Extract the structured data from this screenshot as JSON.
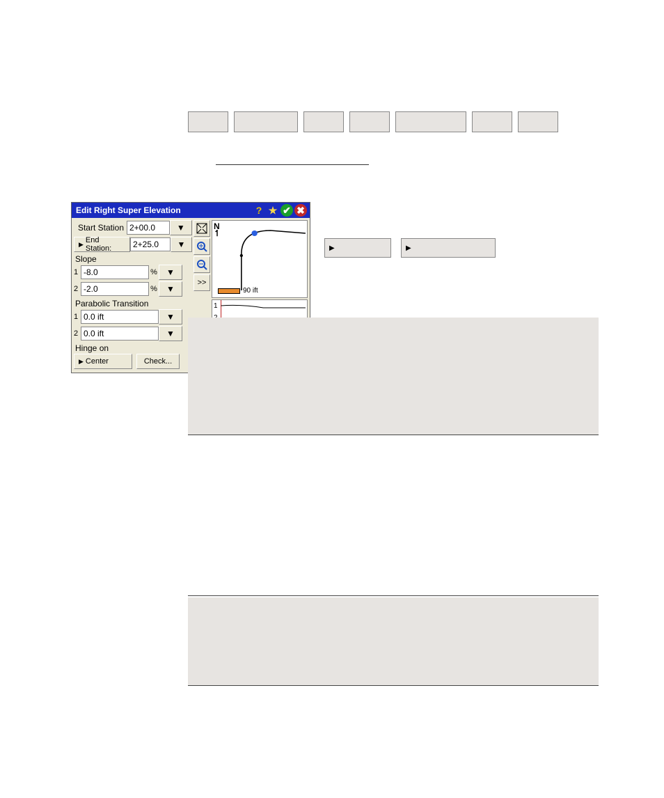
{
  "dialog": {
    "title": "Edit Right Super Elevation",
    "start_station_label": "Start Station",
    "start_station_value": "2+00.0",
    "end_station_button": "End Station:",
    "end_station_value": "2+25.0",
    "slope_section": "Slope",
    "slope1_value": "-8.0",
    "slope2_value": "-2.0",
    "percent": "%",
    "parabolic_section": "Parabolic Transition",
    "parab1_value": "0.0 ift",
    "parab2_value": "0.0 ift",
    "hinge_section": "Hinge on",
    "hinge_button": "Center",
    "check_button": "Check...",
    "toolbar": {
      "chevrons": ">>"
    },
    "plan": {
      "north": "N",
      "scale_label": "90 ift"
    },
    "profile": {
      "label1": "1",
      "label2": "2"
    }
  },
  "labels": {
    "one": "1",
    "two": "2"
  }
}
